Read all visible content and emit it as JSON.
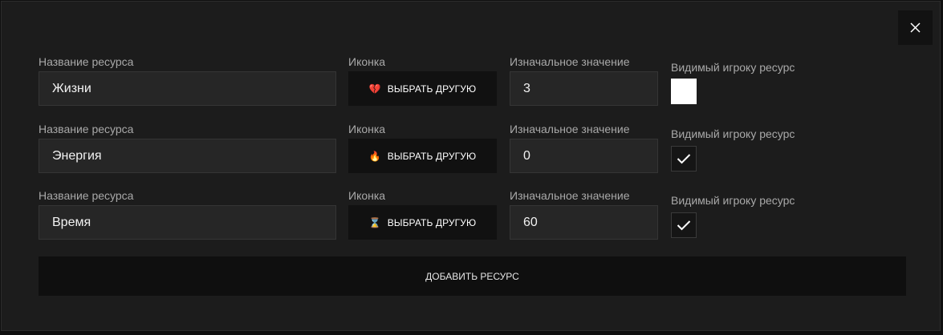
{
  "modal": {
    "close_icon": "close-icon",
    "add_button_label": "ДОБАВИТЬ РЕСУРС"
  },
  "labels": {
    "name": "Название ресурса",
    "icon": "Иконка",
    "initial_value": "Изначальное значение",
    "visible": "Видимый игроку ресурс"
  },
  "resources": [
    {
      "name": "Жизни",
      "icon": "broken-heart-icon",
      "icon_glyph": "💔",
      "icon_button_label": "ВЫБРАТЬ ДРУГУЮ",
      "initial_value": "3",
      "visible": false
    },
    {
      "name": "Энергия",
      "icon": "fire-icon",
      "icon_glyph": "🔥",
      "icon_button_label": "ВЫБРАТЬ ДРУГУЮ",
      "initial_value": "0",
      "visible": true
    },
    {
      "name": "Время",
      "icon": "hourglass-icon",
      "icon_glyph": "⌛",
      "icon_button_label": "ВЫБРАТЬ ДРУГУЮ",
      "initial_value": "60",
      "visible": true
    }
  ],
  "colors": {
    "background": "#1c1c1c",
    "input_background": "#262626",
    "button_background": "#111111"
  }
}
